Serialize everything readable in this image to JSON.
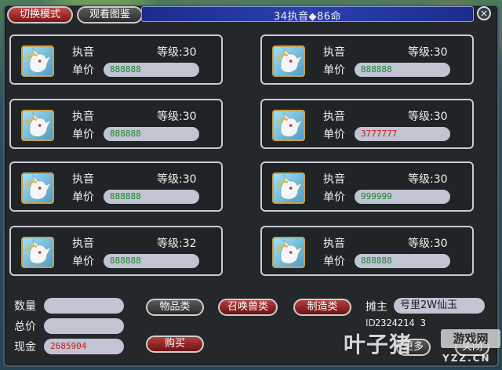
{
  "header": {
    "switch_mode_label": "切换模式",
    "view_gallery_label": "观看图鉴",
    "title": "34执音◆86命",
    "close_label": "×"
  },
  "slots": [
    {
      "name": "执音",
      "level": "等级:30",
      "price_label": "单价",
      "price": "888888",
      "price_color": "#1a8a2a"
    },
    {
      "name": "执音",
      "level": "等级:30",
      "price_label": "单价",
      "price": "888888",
      "price_color": "#1a8a2a"
    },
    {
      "name": "执音",
      "level": "等级:30",
      "price_label": "单价",
      "price": "888888",
      "price_color": "#1a8a2a"
    },
    {
      "name": "执音",
      "level": "等级:30",
      "price_label": "单价",
      "price": "3777777",
      "price_color": "#d01818"
    },
    {
      "name": "执音",
      "level": "等级:30",
      "price_label": "单价",
      "price": "888888",
      "price_color": "#1a8a2a"
    },
    {
      "name": "执音",
      "level": "等级:30",
      "price_label": "单价",
      "price": "999999",
      "price_color": "#1a8a2a"
    },
    {
      "name": "执音",
      "level": "等级:32",
      "price_label": "单价",
      "price": "888888",
      "price_color": "#1a8a2a"
    },
    {
      "name": "执音",
      "level": "等级:30",
      "price_label": "单价",
      "price": "888888",
      "price_color": "#1a8a2a"
    }
  ],
  "footer": {
    "quantity_label": "数量",
    "quantity_value": "",
    "total_label": "总价",
    "total_value": "",
    "cash_label": "现金",
    "cash_value": "2685904",
    "categories": [
      "物品类",
      "召唤兽类",
      "制造类"
    ],
    "buy_label": "购买",
    "owner_label": "摊主",
    "owner_name": "号里2W仙玉",
    "id_label": "ID",
    "owner_id": "2324214 3",
    "next_label": "更多",
    "close_shop_label": "关闭"
  },
  "watermark": {
    "main": "叶子猪",
    "box": "游戏网",
    "url": "YZZ.CN"
  },
  "colors": {
    "active_tab": "#c44a4a",
    "title_bar": "#2b3fb0",
    "price_green": "#1a8a2a",
    "price_red": "#d01818"
  },
  "icons": {
    "pet": "white-fox-spirit-icon",
    "close": "close-icon"
  }
}
